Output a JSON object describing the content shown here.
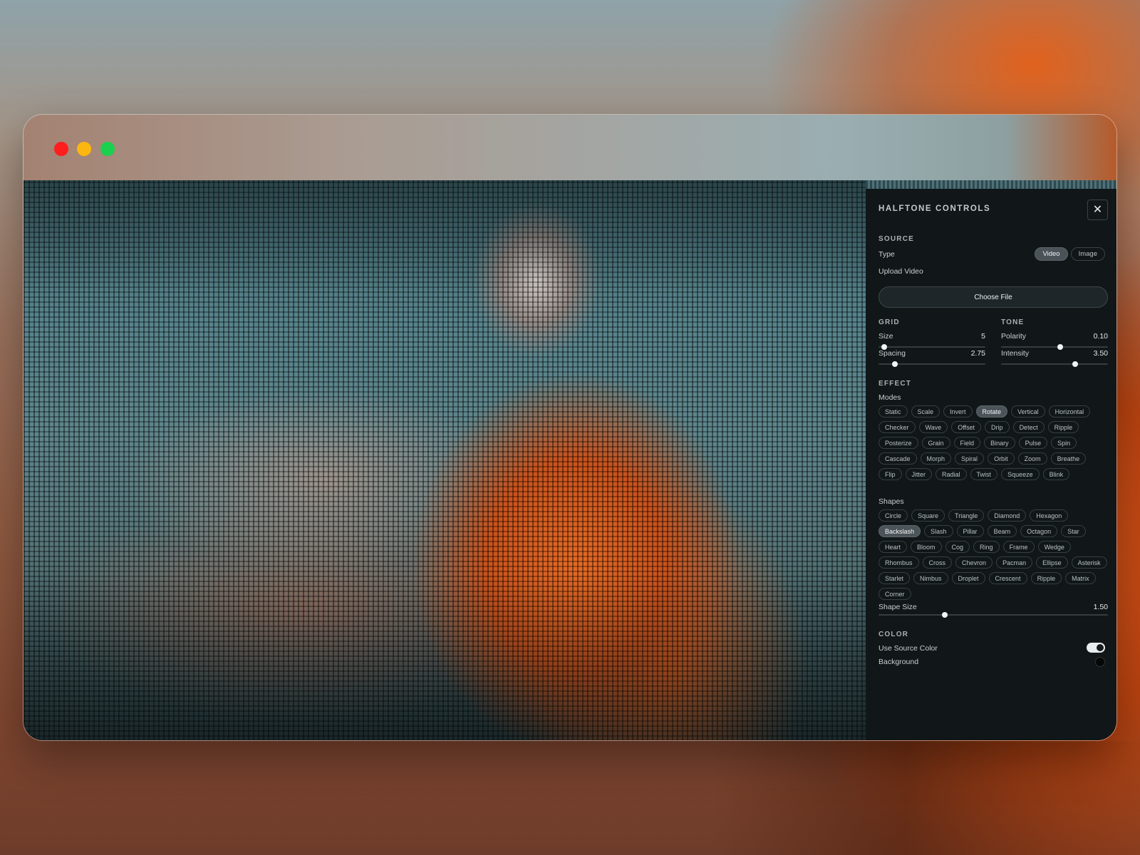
{
  "panel": {
    "title": "HALFTONE CONTROLS",
    "source": {
      "section_label": "SOURCE",
      "type_label": "Type",
      "type_options": [
        "Video",
        "Image"
      ],
      "type_selected": "Video",
      "upload_label": "Upload Video",
      "choose_file_label": "Choose File"
    },
    "grid": {
      "section_label": "GRID",
      "size_label": "Size",
      "size_value": "5",
      "size_fraction": 0.05,
      "spacing_label": "Spacing",
      "spacing_value": "2.75",
      "spacing_fraction": 0.15
    },
    "tone": {
      "section_label": "TONE",
      "polarity_label": "Polarity",
      "polarity_value": "0.10",
      "polarity_fraction": 0.55,
      "intensity_label": "Intensity",
      "intensity_value": "3.50",
      "intensity_fraction": 0.69
    },
    "effect": {
      "section_label": "EFFECT",
      "modes_label": "Modes",
      "modes": [
        "Static",
        "Scale",
        "Invert",
        "Rotate",
        "Vertical",
        "Horizontal",
        "Checker",
        "Wave",
        "Offset",
        "Drip",
        "Detect",
        "Ripple",
        "Posterize",
        "Grain",
        "Field",
        "Binary",
        "Pulse",
        "Spin",
        "Cascade",
        "Morph",
        "Spiral",
        "Orbit",
        "Zoom",
        "Breathe",
        "Flip",
        "Jitter",
        "Radial",
        "Twist",
        "Squeeze",
        "Blink"
      ],
      "mode_selected": "Rotate",
      "shapes_label": "Shapes",
      "shapes": [
        "Circle",
        "Square",
        "Triangle",
        "Diamond",
        "Hexagon",
        "Backslash",
        "Slash",
        "Pillar",
        "Beam",
        "Octagon",
        "Star",
        "Heart",
        "Bloom",
        "Cog",
        "Ring",
        "Frame",
        "Wedge",
        "Rhombus",
        "Cross",
        "Chevron",
        "Pacman",
        "Ellipse",
        "Asterisk",
        "Starlet",
        "Nimbus",
        "Droplet",
        "Crescent",
        "Ripple",
        "Matrix",
        "Corner"
      ],
      "shape_selected": "Backslash",
      "shape_size_label": "Shape Size",
      "shape_size_value": "1.50",
      "shape_size_fraction": 0.29
    },
    "color": {
      "section_label": "COLOR",
      "use_source_label": "Use Source Color",
      "use_source_on": true,
      "background_label": "Background",
      "background_color": "#050707"
    }
  },
  "colors": {
    "traffic_red": "#fe1e1e",
    "traffic_yellow": "#fbb70f",
    "traffic_green": "#1ad04d",
    "panel_bg": "#111719",
    "active_chip": "#4b5458"
  }
}
